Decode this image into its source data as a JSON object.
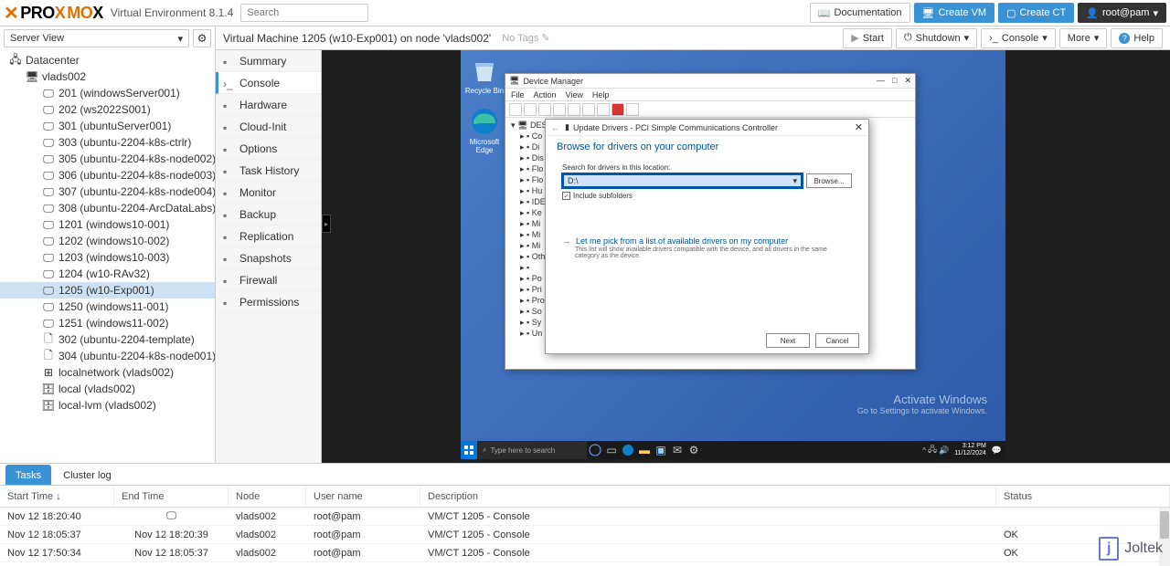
{
  "header": {
    "logo_prefix": "PRO",
    "logo_accent": "MO",
    "logo_suffix": "X",
    "env": "Virtual Environment 8.1.4",
    "search_placeholder": "Search",
    "docs": "Documentation",
    "create_vm": "Create VM",
    "create_ct": "Create CT",
    "user": "root@pam"
  },
  "viewselect": {
    "label": "Server View"
  },
  "context": {
    "crumb": "Virtual Machine 1205 (w10-Exp001) on node 'vlads002'",
    "notags": "No Tags",
    "start": "Start",
    "shutdown": "Shutdown",
    "console": "Console",
    "more": "More",
    "help": "Help"
  },
  "tree": [
    {
      "lvl": 0,
      "icon": "server",
      "label": "Datacenter"
    },
    {
      "lvl": 1,
      "icon": "node",
      "label": "vlads002"
    },
    {
      "lvl": 2,
      "icon": "vm",
      "label": "201 (windowsServer001)"
    },
    {
      "lvl": 2,
      "icon": "vm",
      "label": "202 (ws2022S001)"
    },
    {
      "lvl": 2,
      "icon": "vm",
      "label": "301 (ubuntuServer001)"
    },
    {
      "lvl": 2,
      "icon": "vm",
      "label": "303 (ubuntu-2204-k8s-ctrlr)"
    },
    {
      "lvl": 2,
      "icon": "vm",
      "label": "305 (ubuntu-2204-k8s-node002)"
    },
    {
      "lvl": 2,
      "icon": "vm",
      "label": "306 (ubuntu-2204-k8s-node003)"
    },
    {
      "lvl": 2,
      "icon": "vm",
      "label": "307 (ubuntu-2204-k8s-node004)"
    },
    {
      "lvl": 2,
      "icon": "vm",
      "label": "308 (ubuntu-2204-ArcDataLabs)"
    },
    {
      "lvl": 2,
      "icon": "vm",
      "label": "1201 (windows10-001)"
    },
    {
      "lvl": 2,
      "icon": "vm",
      "label": "1202 (windows10-002)"
    },
    {
      "lvl": 2,
      "icon": "vm",
      "label": "1203 (windows10-003)"
    },
    {
      "lvl": 2,
      "icon": "vm",
      "label": "1204 (w10-RAv32)"
    },
    {
      "lvl": 2,
      "icon": "vm",
      "label": "1205 (w10-Exp001)",
      "sel": true
    },
    {
      "lvl": 2,
      "icon": "vm",
      "label": "1250 (windows11-001)"
    },
    {
      "lvl": 2,
      "icon": "vm",
      "label": "1251 (windows11-002)"
    },
    {
      "lvl": 2,
      "icon": "tmpl",
      "label": "302 (ubuntu-2204-template)"
    },
    {
      "lvl": 2,
      "icon": "tmpl",
      "label": "304 (ubuntu-2204-k8s-node001)"
    },
    {
      "lvl": 2,
      "icon": "net",
      "label": "localnetwork (vlads002)"
    },
    {
      "lvl": 2,
      "icon": "disk",
      "label": "local (vlads002)"
    },
    {
      "lvl": 2,
      "icon": "disk",
      "label": "local-lvm (vlads002)"
    }
  ],
  "vmtabs": [
    {
      "label": "Summary"
    },
    {
      "label": "Console",
      "active": true
    },
    {
      "label": "Hardware"
    },
    {
      "label": "Cloud-Init"
    },
    {
      "label": "Options"
    },
    {
      "label": "Task History"
    },
    {
      "label": "Monitor"
    },
    {
      "label": "Backup"
    },
    {
      "label": "Replication"
    },
    {
      "label": "Snapshots"
    },
    {
      "label": "Firewall"
    },
    {
      "label": "Permissions"
    }
  ],
  "vm": {
    "desktop": {
      "recycle": "Recycle Bin",
      "edge": "Microsoft Edge",
      "activate_title": "Activate Windows",
      "activate_sub": "Go to Settings to activate Windows."
    },
    "taskbar": {
      "search": "Type here to search",
      "time1": "3:12 PM",
      "time2": "11/12/2024"
    },
    "devmgr": {
      "title": "Device Manager",
      "menu": [
        "File",
        "Action",
        "View",
        "Help"
      ],
      "root": "DESKT",
      "rows": [
        "Co",
        "Di",
        "Dis",
        "Flo",
        "Flo",
        "Hu",
        "IDE",
        "Ke",
        "Mi",
        "Mi",
        "Mi",
        "Oth",
        "",
        "Po",
        "Pri",
        "Pro",
        "So",
        "Sy",
        "Un"
      ]
    },
    "wizard": {
      "title": "Update Drivers - PCI Simple Communications Controller",
      "head": "Browse for drivers on your computer",
      "path_label": "Search for drivers in this location:",
      "path_value": "D:\\",
      "browse": "Browse...",
      "include": "Include subfolders",
      "pick": "Let me pick from a list of available drivers on my computer",
      "pick_sub": "This list will show available drivers compatible with the device, and all drivers in the same category as the device.",
      "next": "Next",
      "cancel": "Cancel"
    }
  },
  "log": {
    "tabs": [
      "Tasks",
      "Cluster log"
    ],
    "cols": [
      "Start Time ↓",
      "End Time",
      "Node",
      "User name",
      "Description",
      "Status"
    ],
    "rows": [
      {
        "start": "Nov 12 18:20:40",
        "end_icon": true,
        "end": "",
        "node": "vlads002",
        "user": "root@pam",
        "desc": "VM/CT 1205 - Console",
        "status": ""
      },
      {
        "start": "Nov 12 18:05:37",
        "end": "Nov 12 18:20:39",
        "node": "vlads002",
        "user": "root@pam",
        "desc": "VM/CT 1205 - Console",
        "status": "OK"
      },
      {
        "start": "Nov 12 17:50:34",
        "end": "Nov 12 18:05:37",
        "node": "vlads002",
        "user": "root@pam",
        "desc": "VM/CT 1205 - Console",
        "status": "OK"
      }
    ]
  },
  "watermark": "Joltek"
}
